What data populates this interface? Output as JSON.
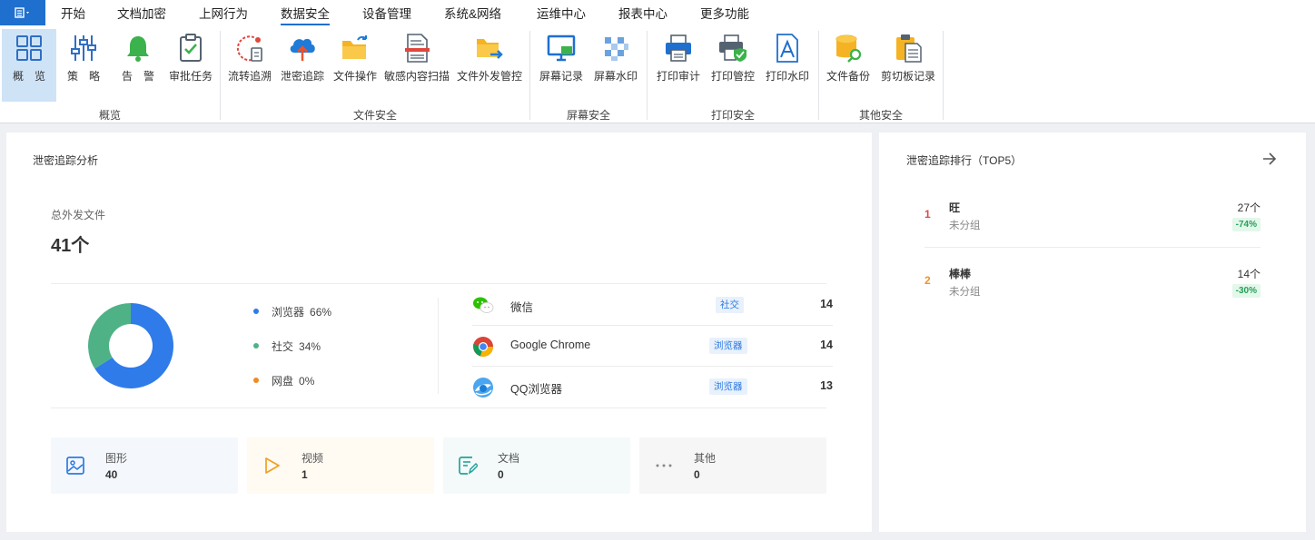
{
  "menu": {
    "tabs": [
      "开始",
      "文档加密",
      "上网行为",
      "数据安全",
      "设备管理",
      "系统&网络",
      "运维中心",
      "报表中心",
      "更多功能"
    ],
    "active_tab": "数据安全"
  },
  "ribbon": {
    "groups": [
      {
        "label": "概览",
        "buttons": [
          "概　览",
          "策　略",
          "告　警",
          "审批任务"
        ]
      },
      {
        "label": "文件安全",
        "buttons": [
          "流转追溯",
          "泄密追踪",
          "文件操作",
          "敏感内容扫描",
          "文件外发管控"
        ]
      },
      {
        "label": "屏幕安全",
        "buttons": [
          "屏幕记录",
          "屏幕水印"
        ]
      },
      {
        "label": "打印安全",
        "buttons": [
          "打印审计",
          "打印管控",
          "打印水印"
        ]
      },
      {
        "label": "其他安全",
        "buttons": [
          "文件备份",
          "剪切板记录"
        ]
      }
    ]
  },
  "analysis": {
    "title": "泄密追踪分析",
    "total_label": "总外发文件",
    "total_value": "41个",
    "donut": [
      {
        "name": "浏览器",
        "percent_text": "66%",
        "value": 66,
        "color": "#2f7be9"
      },
      {
        "name": "社交",
        "percent_text": "34%",
        "value": 34,
        "color": "#4fb286"
      },
      {
        "name": "网盘",
        "percent_text": "0%",
        "value": 0,
        "color": "#f08a24"
      }
    ],
    "apps": [
      {
        "name": "微信",
        "tag": "社交",
        "count": "14",
        "icon": "wechat-icon"
      },
      {
        "name": "Google Chrome",
        "tag": "浏览器",
        "count": "14",
        "icon": "chrome-icon"
      },
      {
        "name": "QQ浏览器",
        "tag": "浏览器",
        "count": "13",
        "icon": "qq-browser-icon"
      }
    ],
    "file_types": [
      {
        "name": "图形",
        "count": "40",
        "icon": "image-icon",
        "bg": "#f4f8fd"
      },
      {
        "name": "视频",
        "count": "1",
        "icon": "play-icon",
        "bg": "#fffaf2"
      },
      {
        "name": "文档",
        "count": "0",
        "icon": "document-icon",
        "bg": "#f4fafa"
      },
      {
        "name": "其他",
        "count": "0",
        "icon": "more-icon",
        "bg": "#f6f6f7"
      }
    ]
  },
  "ranking": {
    "title": "泄密追踪排行（TOP5）",
    "items": [
      {
        "rank": "1",
        "name": "旺",
        "group": "未分组",
        "count": "27个",
        "change": "-74%",
        "rank_color": "#e04848"
      },
      {
        "rank": "2",
        "name": "棒棒",
        "group": "未分组",
        "count": "14个",
        "change": "-30%",
        "rank_color": "#f0922a"
      }
    ]
  }
}
